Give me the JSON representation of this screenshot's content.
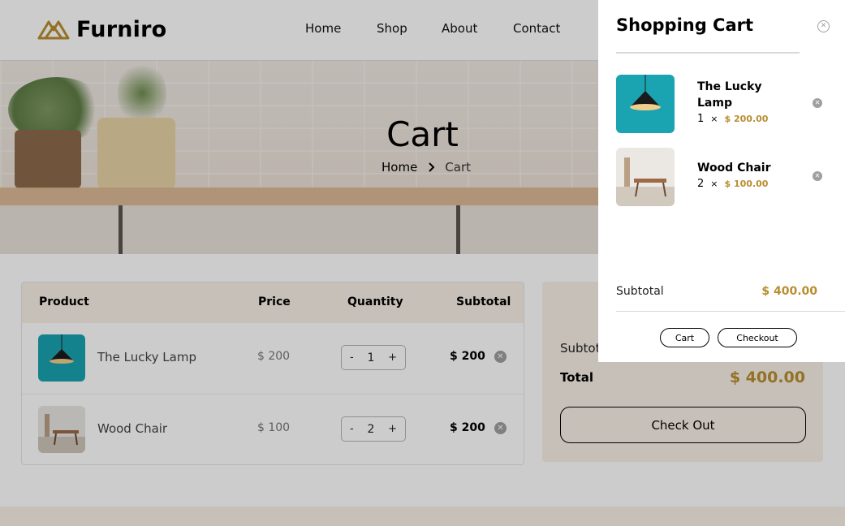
{
  "brand": {
    "name": "Furniro",
    "accent": "#B88E2F"
  },
  "nav": {
    "home": "Home",
    "shop": "Shop",
    "about": "About",
    "contact": "Contact"
  },
  "hero": {
    "title": "Cart",
    "breadcrumb_home": "Home",
    "breadcrumb_current": "Cart"
  },
  "table": {
    "headers": {
      "product": "Product",
      "price": "Price",
      "quantity": "Quantity",
      "subtotal": "Subtotal"
    },
    "rows": [
      {
        "name": "The Lucky Lamp",
        "price": "$ 200",
        "qty": "1",
        "subtotal": "$ 200"
      },
      {
        "name": "Wood Chair",
        "price": "$ 100",
        "qty": "2",
        "subtotal": "$ 200"
      }
    ],
    "minus": "-",
    "plus": "+"
  },
  "totals": {
    "subtotal_label": "Subtotal",
    "total_label": "Total",
    "total_value": "$ 400.00",
    "checkout": "Check Out"
  },
  "drawer": {
    "title": "Shopping Cart",
    "items": [
      {
        "name": "The Lucky Lamp",
        "qty": "1",
        "times": "×",
        "price": "$ 200.00"
      },
      {
        "name": "Wood Chair",
        "qty": "2",
        "times": "×",
        "price": "$ 100.00"
      }
    ],
    "subtotal_label": "Subtotal",
    "subtotal_value": "$ 400.00",
    "cart_button": "Cart",
    "checkout_button": "Checkout"
  },
  "icons": {
    "close": "close-icon",
    "remove": "remove-icon",
    "chevron": "chevron-right-icon",
    "logo": "logo-icon"
  }
}
